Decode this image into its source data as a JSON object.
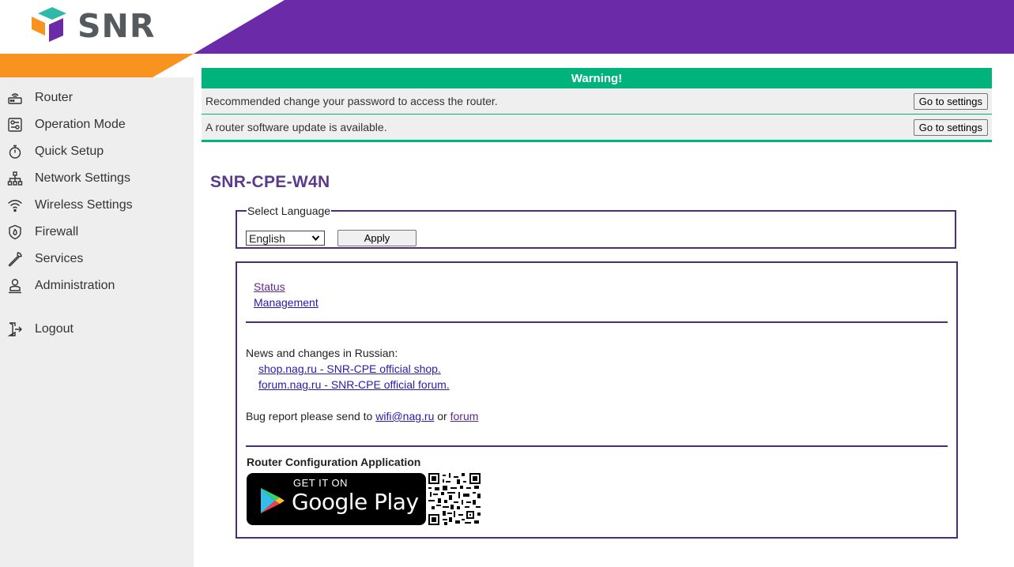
{
  "brand": {
    "name": "SNR",
    "accent_purple": "#6b2aa8",
    "accent_orange": "#f7931e",
    "accent_green": "#00b27c"
  },
  "sidebar": {
    "items": [
      {
        "label": "Router",
        "icon": "router-icon"
      },
      {
        "label": "Operation Mode",
        "icon": "operation-mode-icon"
      },
      {
        "label": "Quick Setup",
        "icon": "stopwatch-icon"
      },
      {
        "label": "Network Settings",
        "icon": "network-icon"
      },
      {
        "label": "Wireless Settings",
        "icon": "wifi-icon"
      },
      {
        "label": "Firewall",
        "icon": "shield-icon"
      },
      {
        "label": "Services",
        "icon": "wrench-icon"
      },
      {
        "label": "Administration",
        "icon": "admin-icon"
      }
    ],
    "logout": {
      "label": "Logout",
      "icon": "logout-icon"
    }
  },
  "warning": {
    "title": "Warning!",
    "rows": [
      {
        "message": "Recommended change your password to access the router.",
        "button": "Go to settings"
      },
      {
        "message": "A router software update is available.",
        "button": "Go to settings"
      }
    ]
  },
  "device": {
    "title": "SNR-CPE-W4N"
  },
  "language": {
    "legend": "Select Language",
    "selected": "English",
    "apply_label": "Apply"
  },
  "links": {
    "status": "Status",
    "management": "Management"
  },
  "news": {
    "title": "News and changes in Russian:",
    "shop": "shop.nag.ru - SNR-CPE official shop.",
    "forum": "forum.nag.ru - SNR-CPE official forum."
  },
  "bug": {
    "prefix": "Bug report please send to ",
    "email": "wifi@nag.ru",
    "middle": " or ",
    "forum": "forum"
  },
  "app": {
    "title": "Router Configuration Application",
    "get_it_on": "GET IT ON",
    "store": "Google Play"
  }
}
